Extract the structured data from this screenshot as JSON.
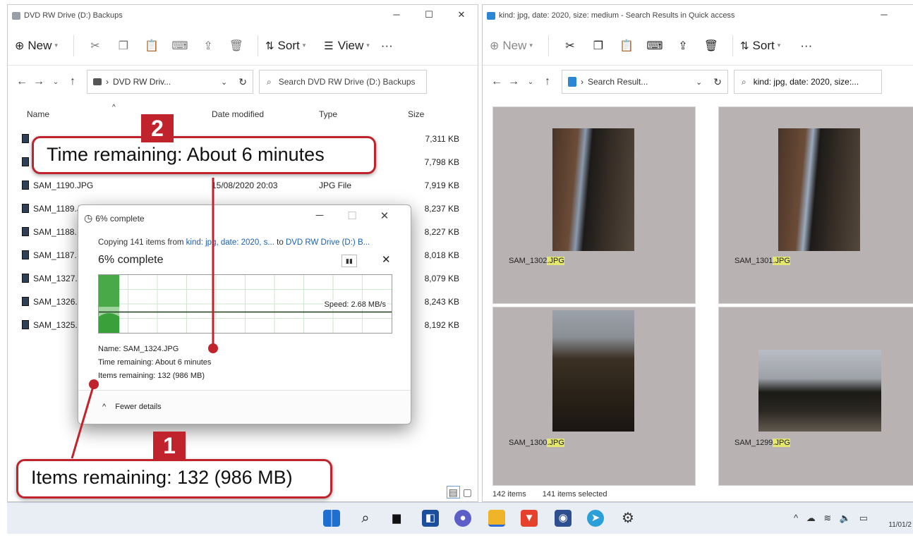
{
  "left_window": {
    "title": "DVD RW Drive (D:) Backups",
    "commands": {
      "new": "New",
      "sort": "Sort",
      "view": "View",
      "more": "···"
    },
    "address": "DVD RW Driv...",
    "search_placeholder": "Search DVD RW Drive (D:) Backups",
    "columns": {
      "name": "Name",
      "date": "Date modified",
      "type": "Type",
      "size": "Size"
    },
    "files": [
      {
        "name": "",
        "date": "",
        "type": "",
        "size": "7,311 KB"
      },
      {
        "name": "",
        "date": "",
        "type": "",
        "size": "7,798 KB"
      },
      {
        "name": "SAM_1190.JPG",
        "date": "15/08/2020 20:03",
        "type": "JPG File",
        "size": "7,919 KB"
      },
      {
        "name": "SAM_1189.JPG",
        "date": "",
        "type": "",
        "size": "8,237 KB"
      },
      {
        "name": "SAM_1188.",
        "date": "",
        "type": "",
        "size": "8,227 KB"
      },
      {
        "name": "SAM_1187.",
        "date": "",
        "type": "",
        "size": "8,018 KB"
      },
      {
        "name": "SAM_1327.",
        "date": "",
        "type": "",
        "size": "8,079 KB"
      },
      {
        "name": "SAM_1326.",
        "date": "",
        "type": "",
        "size": "8,243 KB"
      },
      {
        "name": "SAM_1325.",
        "date": "",
        "type": "",
        "size": "8,192 KB"
      }
    ]
  },
  "right_window": {
    "title": "kind: jpg, date: 2020, size: medium - Search Results in Quick access",
    "commands": {
      "new": "New",
      "sort": "Sort",
      "more": "···"
    },
    "address": "Search Result...",
    "search_value": "kind: jpg, date: 2020, size:...",
    "thumbnails": [
      {
        "base": "SAM_1302",
        "ext": ".JPG"
      },
      {
        "base": "SAM_1301",
        "ext": ".JPG"
      },
      {
        "base": "SAM_1300",
        "ext": ".JPG"
      },
      {
        "base": "SAM_1299",
        "ext": ".JPG"
      }
    ],
    "status": {
      "items": "142 items",
      "selected": "141 items selected"
    }
  },
  "dialog": {
    "title": "6% complete",
    "copy_prefix": "Copying 141 items from ",
    "copy_source": "kind: jpg, date: 2020, s...",
    "copy_to": " to ",
    "copy_dest": "DVD RW Drive (D:) B...",
    "percent_text": "6% complete",
    "progress": 0.06,
    "speed": "Speed: 2.68 MB/s",
    "name_line": "Name:  SAM_1324.JPG",
    "time_line": "Time remaining:  About 6 minutes",
    "items_line": "Items remaining:  132 (986 MB)",
    "fewer_details": "Fewer details"
  },
  "callouts": {
    "time": {
      "badge": "2",
      "text": "Time remaining:  About 6 minutes"
    },
    "items": {
      "badge": "1",
      "text": "Items remaining:  132 (986 MB)"
    }
  },
  "taskbar": {
    "clock": "11/01/2"
  },
  "colors": {
    "accent_red": "#c0232c",
    "progress_green": "#3aa13a",
    "thumb_bg": "#b8b2b2",
    "highlight": "#e3e66f"
  }
}
